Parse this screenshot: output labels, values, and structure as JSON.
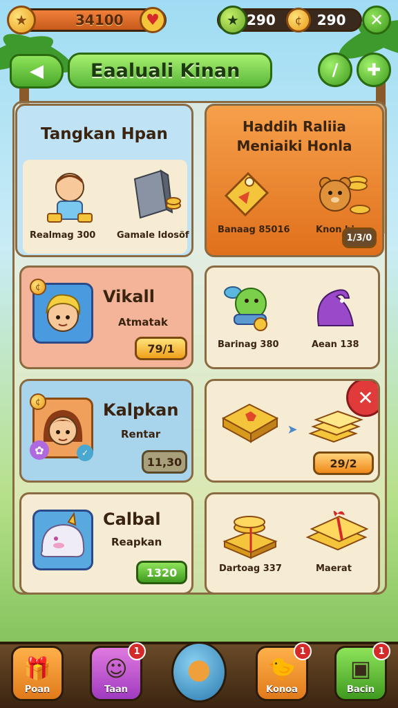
{
  "top_bar": {
    "left_value": "34100",
    "right_value_1": "290",
    "right_value_2": "290"
  },
  "header": {
    "title": "Eaaluali Kinan"
  },
  "cards": {
    "left1": {
      "title": "Tangkan Hpan",
      "caption1": "Realmag 300",
      "caption2": "Gamale ldosöf"
    },
    "right1": {
      "title": "Haddih Raliia Meniaiki Honla",
      "caption1": "Banaag 85016",
      "caption2": "Knon bi",
      "value": "1/3/0"
    },
    "left2": {
      "title": "Vikall",
      "subtitle": "Atmatak",
      "value": "79/1"
    },
    "right2": {
      "caption1": "Barinag 380",
      "caption2": "Aean 138"
    },
    "left3": {
      "title": "Kalpkan",
      "subtitle": "Rentar",
      "value": "11,30"
    },
    "right3": {
      "value": "29/2"
    },
    "left4": {
      "title": "Calbal",
      "subtitle": "Reapkan",
      "value": "1320"
    },
    "right4": {
      "caption1": "Dartoag 337",
      "caption2": "Maerat"
    }
  },
  "nav": {
    "items": [
      {
        "label": "Poan",
        "notif": ""
      },
      {
        "label": "Taan",
        "notif": "1"
      },
      {
        "label": "",
        "notif": ""
      },
      {
        "label": "Konoa",
        "notif": "1"
      },
      {
        "label": "Bacin",
        "notif": "1"
      }
    ]
  },
  "colors": {
    "blue_card": "#bfe2f4",
    "orange_card": "#f0892e",
    "salmon_card": "#f3b49a",
    "cream_card": "#f6ecd4",
    "green_btn": "#5ab83a"
  }
}
